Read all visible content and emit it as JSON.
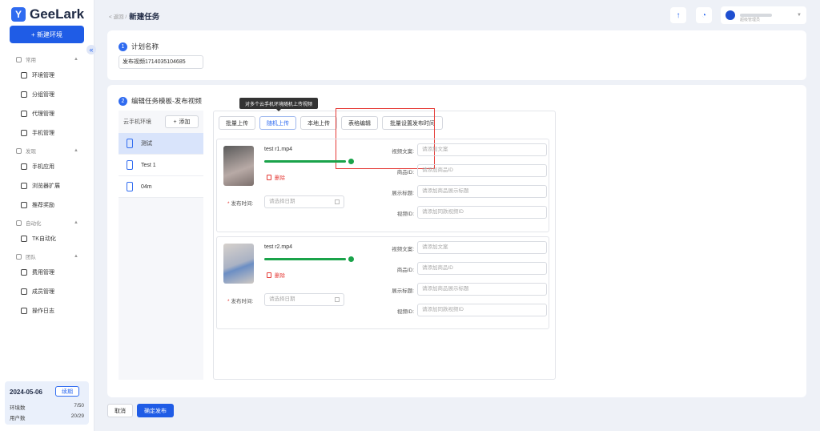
{
  "app": {
    "brand": "GeeLark",
    "new_env": "+ 新建环境"
  },
  "sidebar": {
    "groups": [
      {
        "label": "常用",
        "items": [
          "环境管理",
          "分组管理",
          "代理管理",
          "手机管理"
        ]
      },
      {
        "label": "发现",
        "items": [
          "手机应用",
          "浏览器扩展",
          "推荐奖励"
        ]
      },
      {
        "label": "自动化",
        "items": [
          "TK自动化"
        ]
      },
      {
        "label": "团队",
        "items": [
          "费用管理",
          "成员管理",
          "操作日志"
        ]
      }
    ],
    "footer": {
      "date": "2024-05-06",
      "renew": "续期",
      "env_label": "环境数",
      "env_value": "7/50",
      "user_label": "用户数",
      "user_value": "20/29"
    }
  },
  "header": {
    "back": "< 返回 /",
    "title": "新建任务",
    "user_role": "超级管理员"
  },
  "plan": {
    "num": "1",
    "title": "计划名称",
    "value": "发布视频1714035104685"
  },
  "edit": {
    "num": "2",
    "title": "编辑任务模板-发布视频",
    "env_header": "云手机环境",
    "add": "添加",
    "envs": [
      "测试",
      "Test 1",
      "04m"
    ],
    "tabs": [
      "批量上传",
      "随机上传",
      "本地上传",
      "表格编辑",
      "批量设置发布时间"
    ],
    "tooltip": "对多个云手机环境随机上传视频",
    "videos": [
      {
        "name": "test r1.mp4",
        "progress": 1.0
      },
      {
        "name": "test r2.mp4",
        "progress": 1.0
      }
    ],
    "delete": "删除",
    "publish_time": "发布时间:",
    "date_placeholder": "请选择日期",
    "fields": [
      {
        "label": "视频文案:",
        "placeholder": "请添加文案"
      },
      {
        "label": "商品ID:",
        "placeholder": "请添加商品ID"
      },
      {
        "label": "展示标题:",
        "placeholder": "请添加商品展示标题"
      },
      {
        "label": "视频ID:",
        "placeholder": "请添加同款视频ID"
      }
    ]
  },
  "footer_buttons": {
    "cancel": "取消",
    "confirm": "确定发布"
  }
}
